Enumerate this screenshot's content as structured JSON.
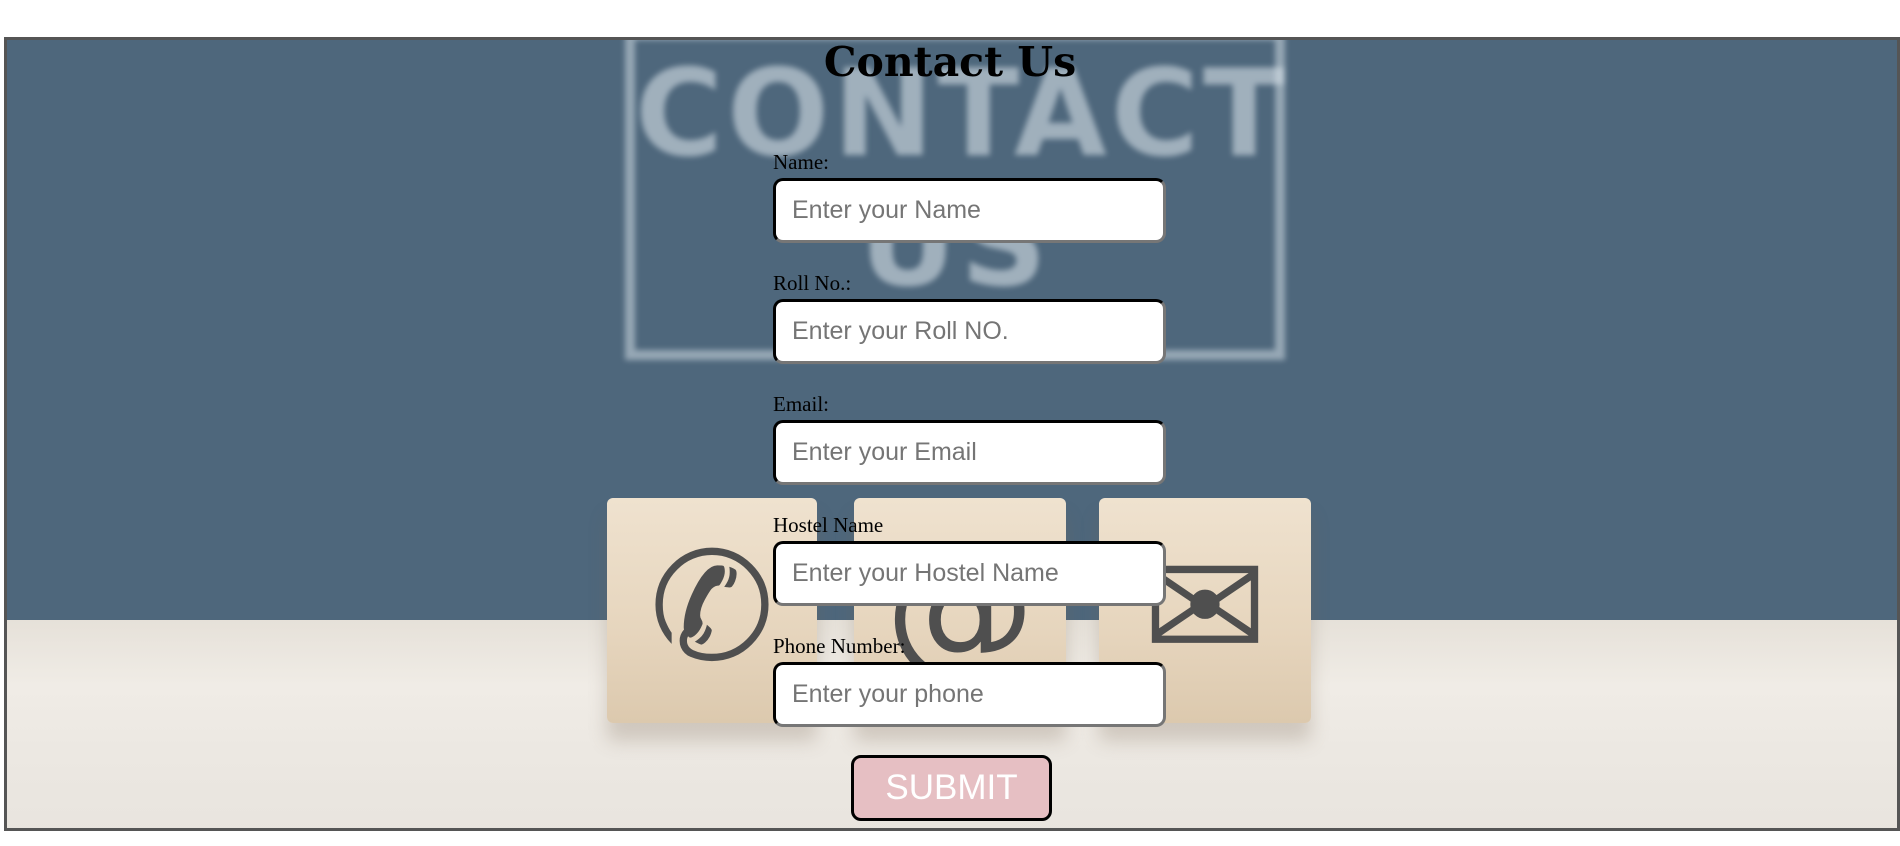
{
  "page": {
    "title": "Contact Us"
  },
  "background": {
    "sign_text": "CONTACT US",
    "blocks": [
      {
        "icon": "phone-icon",
        "glyph": "✆"
      },
      {
        "icon": "at-sign-icon",
        "glyph": "@"
      },
      {
        "icon": "envelope-icon",
        "glyph": "✉"
      }
    ],
    "colors": {
      "wall": "#4e677c",
      "table": "#ece8e2",
      "blocks": "#e6d5bd"
    }
  },
  "form": {
    "fields": [
      {
        "label": "Name:",
        "placeholder": "Enter your Name",
        "value": ""
      },
      {
        "label": "Roll No.:",
        "placeholder": "Enter your Roll NO.",
        "value": ""
      },
      {
        "label": "Email:",
        "placeholder": "Enter your Email",
        "value": ""
      },
      {
        "label": "Hostel Name",
        "placeholder": "Enter your Hostel Name",
        "value": ""
      },
      {
        "label": "Phone Number:",
        "placeholder": "Enter your phone",
        "value": ""
      }
    ],
    "submit_label": "SUBMIT",
    "submit_color": "#e6bfc3"
  }
}
